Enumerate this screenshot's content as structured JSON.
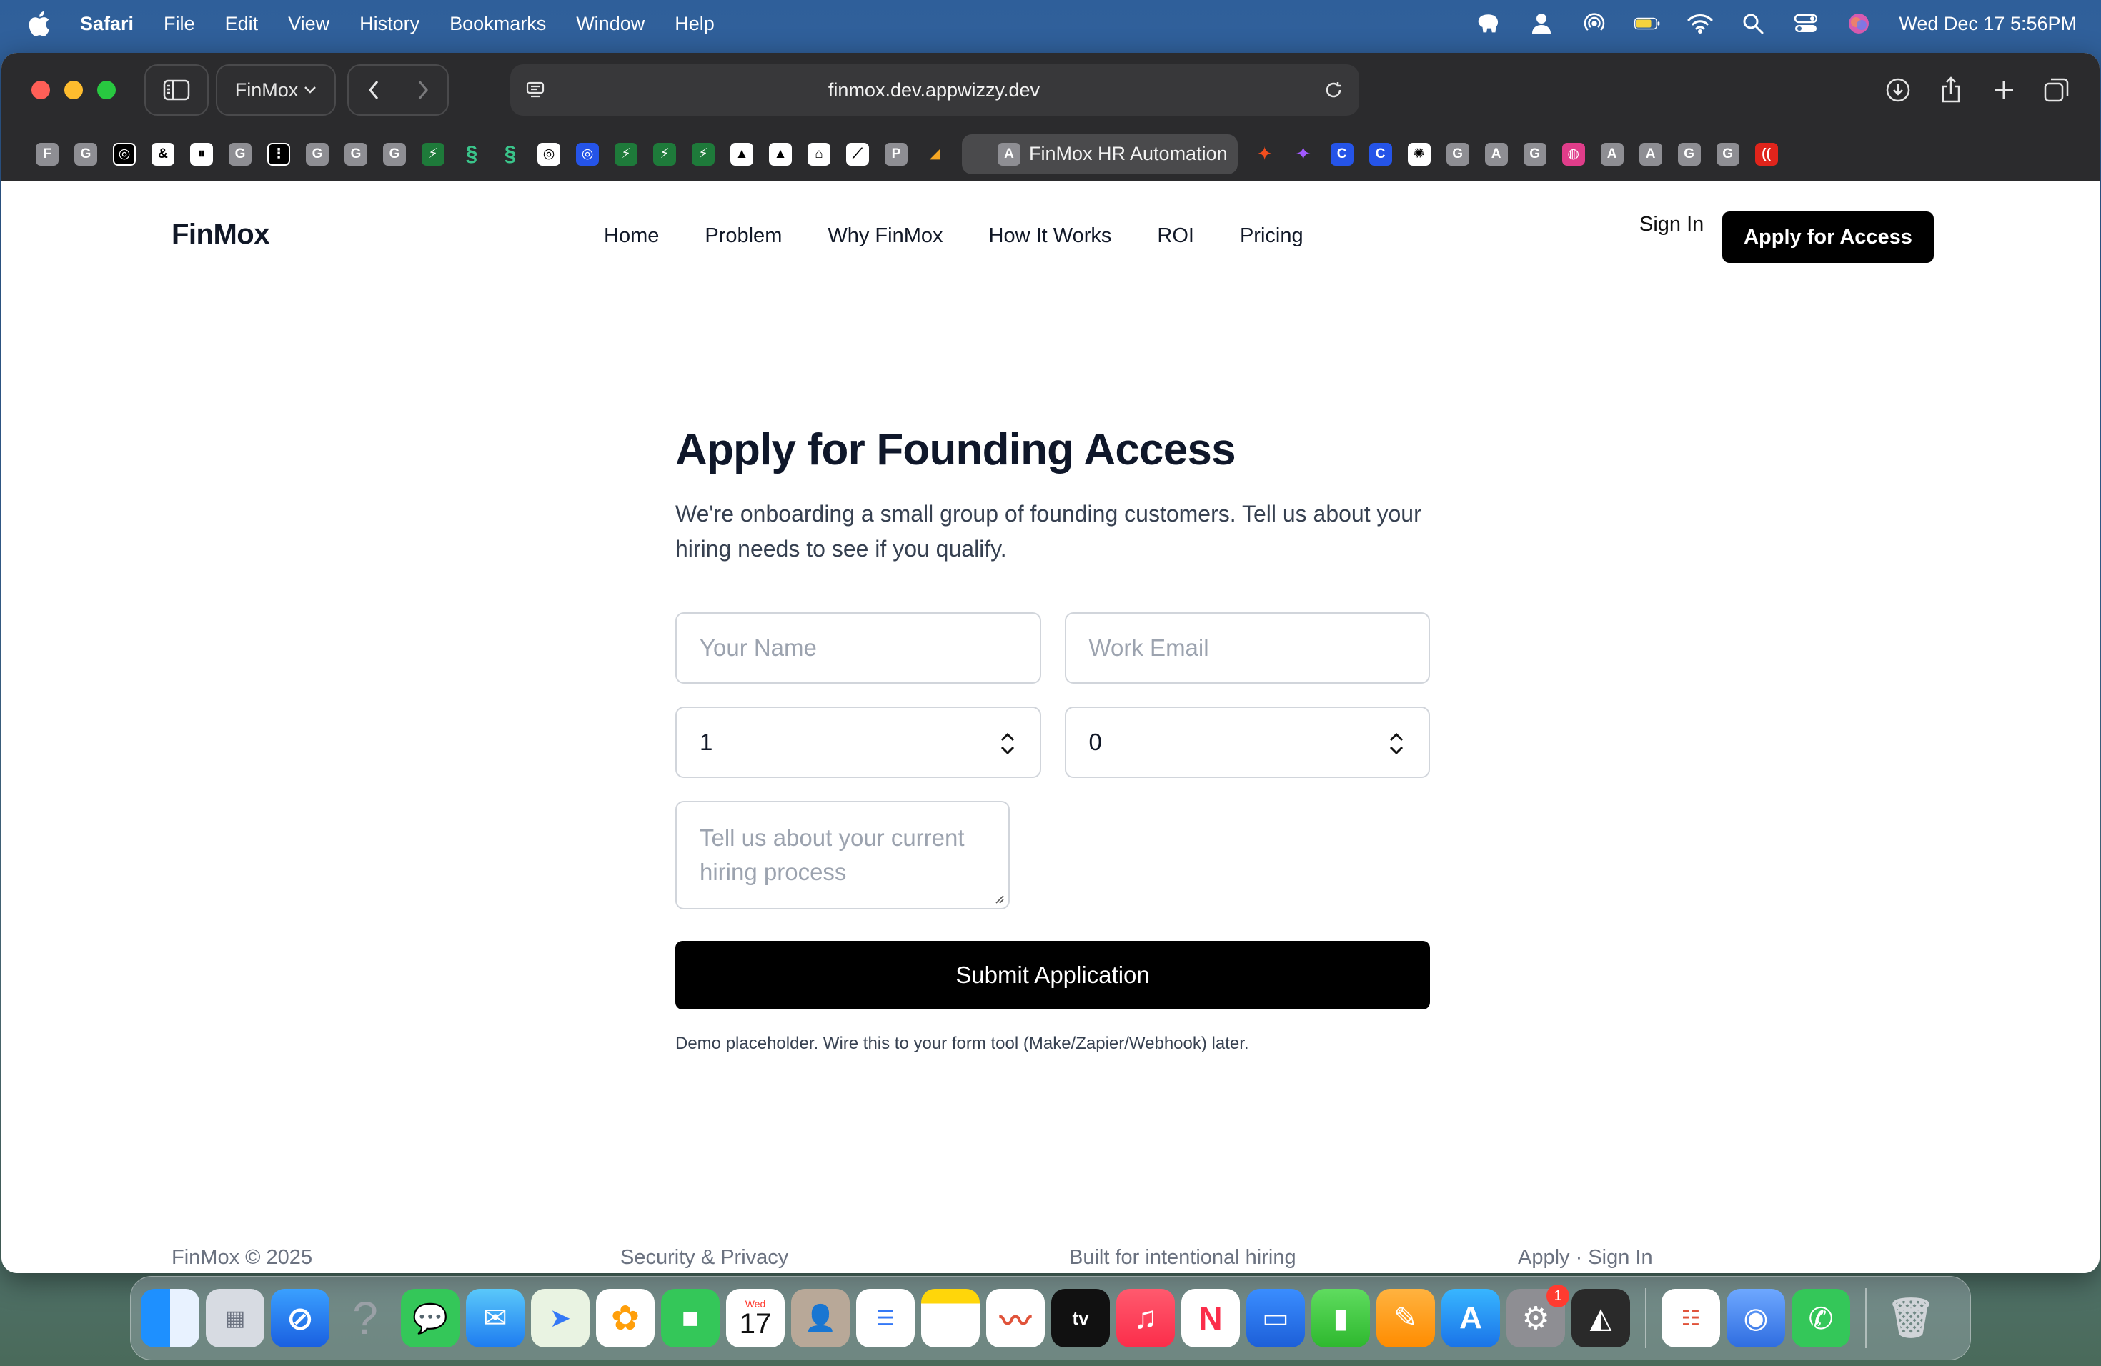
{
  "menubar": {
    "app_name": "Safari",
    "items": [
      "File",
      "Edit",
      "View",
      "History",
      "Bookmarks",
      "Window",
      "Help"
    ],
    "clock": "Wed Dec 17  5:56PM"
  },
  "browser": {
    "tab_group": "FinMox",
    "url": "finmox.dev.appwizzy.dev",
    "active_tab_title": "FinMox HR Automation",
    "favorites": [
      "F",
      "G",
      "",
      "",
      "",
      "G",
      "",
      "G",
      "G",
      "G",
      "",
      "",
      "",
      "",
      "",
      "",
      "",
      "",
      "",
      "",
      "",
      "",
      "",
      "P",
      "",
      "",
      "",
      "",
      "",
      "G",
      "A",
      "G",
      "",
      "A",
      "A",
      "G",
      "G",
      ""
    ]
  },
  "site": {
    "logo": "FinMox",
    "nav": [
      "Home",
      "Problem",
      "Why FinMox",
      "How It Works",
      "ROI",
      "Pricing"
    ],
    "signin": "Sign In",
    "apply_button": "Apply for Access"
  },
  "form": {
    "title": "Apply for Founding Access",
    "subtitle": "We're onboarding a small group of founding customers. Tell us about your hiring needs to see if you qualify.",
    "name_placeholder": "Your Name",
    "email_placeholder": "Work Email",
    "number_one_value": "1",
    "number_two_value": "0",
    "textarea_placeholder": "Tell us about your current hiring process",
    "submit_label": "Submit Application",
    "disclaimer": "Demo placeholder. Wire this to your form tool (Make/Zapier/Webhook) later."
  },
  "footer": {
    "copyright": "FinMox © 2025",
    "security": "Security & Privacy",
    "tagline": "Built for intentional hiring",
    "links": "Apply · Sign In"
  },
  "dock": {
    "calendar_month": "Wed",
    "calendar_day": "17",
    "settings_badge": "1"
  }
}
